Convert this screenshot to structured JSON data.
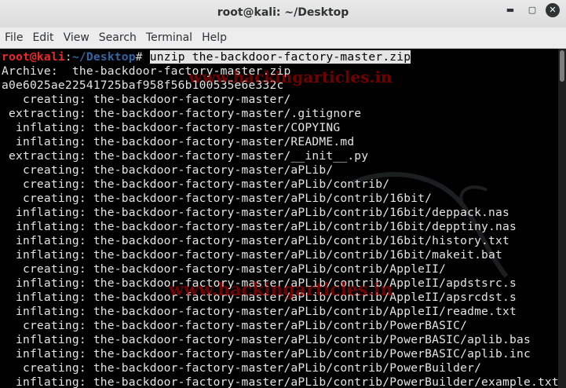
{
  "window": {
    "title": "root@kali: ~/Desktop",
    "minimize_icon": "minimize-icon",
    "maximize_icon": "maximize-icon",
    "close_icon": "close-icon"
  },
  "menu": [
    "File",
    "Edit",
    "View",
    "Search",
    "Terminal",
    "Help"
  ],
  "prompt": {
    "user": "root@kali",
    "colon": ":",
    "path": "~/Desktop",
    "hash": "#",
    "command": "unzip the-backdoor-factory-master.zip"
  },
  "output": [
    "Archive:  the-backdoor-factory-master.zip",
    "a0e6025ae22541725baf958f56b100535e6e332c",
    "   creating: the-backdoor-factory-master/",
    " extracting: the-backdoor-factory-master/.gitignore",
    "  inflating: the-backdoor-factory-master/COPYING",
    "  inflating: the-backdoor-factory-master/README.md",
    " extracting: the-backdoor-factory-master/__init__.py",
    "   creating: the-backdoor-factory-master/aPLib/",
    "   creating: the-backdoor-factory-master/aPLib/contrib/",
    "   creating: the-backdoor-factory-master/aPLib/contrib/16bit/",
    "  inflating: the-backdoor-factory-master/aPLib/contrib/16bit/deppack.nas",
    "  inflating: the-backdoor-factory-master/aPLib/contrib/16bit/depptiny.nas",
    "  inflating: the-backdoor-factory-master/aPLib/contrib/16bit/history.txt",
    "  inflating: the-backdoor-factory-master/aPLib/contrib/16bit/makeit.bat",
    "   creating: the-backdoor-factory-master/aPLib/contrib/AppleII/",
    "  inflating: the-backdoor-factory-master/aPLib/contrib/AppleII/apdstsrc.s",
    "  inflating: the-backdoor-factory-master/aPLib/contrib/AppleII/apsrcdst.s",
    "  inflating: the-backdoor-factory-master/aPLib/contrib/AppleII/readme.txt",
    "   creating: the-backdoor-factory-master/aPLib/contrib/PowerBASIC/",
    "  inflating: the-backdoor-factory-master/aPLib/contrib/PowerBASIC/aplib.bas",
    "  inflating: the-backdoor-factory-master/aPLib/contrib/PowerBASIC/aplib.inc",
    "   creating: the-backdoor-factory-master/aPLib/contrib/PowerBuilder/",
    "  inflating: the-backdoor-factory-master/aPLib/contrib/PowerBuilder/example.txt"
  ],
  "watermark": {
    "top": "www.hackingarticles.in",
    "middle": "www.hackingarticles.in"
  }
}
